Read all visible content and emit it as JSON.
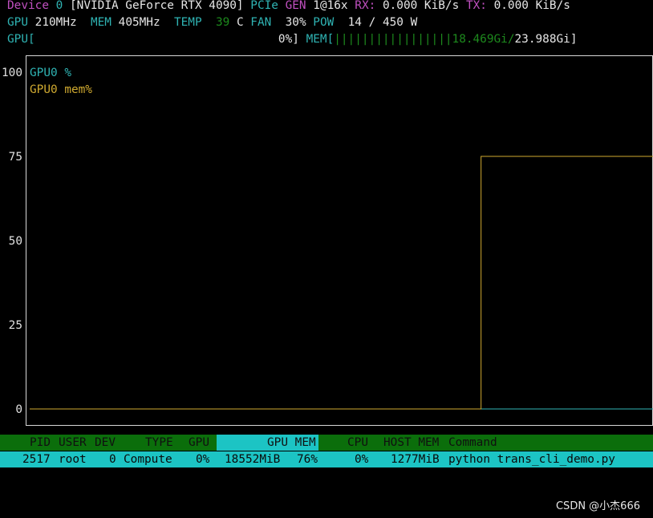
{
  "device": {
    "label": "Device",
    "index": "0",
    "name": "[NVIDIA GeForce RTX 4090]",
    "pcie_label": "PCIe",
    "gen_label": "GEN",
    "gen_value": "1@16x",
    "rx_label": "RX:",
    "rx_value": "0.000 KiB/s",
    "tx_label": "TX:",
    "tx_value": "0.000 KiB/s"
  },
  "stats": {
    "gpu_label": "GPU",
    "gpu_clock": "210MHz",
    "mem_label": "MEM",
    "mem_clock": "405MHz",
    "temp_label": "TEMP",
    "temp_value": "39",
    "temp_unit": "C",
    "fan_label": "FAN",
    "fan_value": "30%",
    "pow_label": "POW",
    "pow_value": "14 / 450 W"
  },
  "meters": {
    "gpu_label": "GPU[",
    "gpu_percent": "0%]",
    "mem_label": "MEM[",
    "mem_bars": "|||||||||||||||||",
    "mem_used": "18.469Gi/",
    "mem_total": "23.988Gi]"
  },
  "chart_data": {
    "type": "line",
    "x": [
      0,
      1,
      2,
      3,
      4,
      5,
      6,
      7,
      8,
      9,
      10,
      11,
      12,
      13,
      14,
      15,
      16,
      17,
      18,
      19,
      20,
      21,
      22,
      23,
      24,
      25,
      26,
      27,
      28,
      29
    ],
    "series": [
      {
        "name": "GPU0 %",
        "color": "#2fb3b3",
        "values": [
          0,
          0,
          0,
          0,
          0,
          0,
          0,
          0,
          0,
          0,
          0,
          0,
          0,
          0,
          0,
          0,
          0,
          0,
          0,
          0,
          0,
          0,
          0,
          0,
          0,
          0,
          0,
          0,
          0,
          0
        ]
      },
      {
        "name": "GPU0 mem%",
        "color": "#d0aa30",
        "values": [
          0,
          0,
          0,
          0,
          0,
          0,
          0,
          0,
          0,
          0,
          0,
          0,
          0,
          0,
          0,
          0,
          0,
          0,
          0,
          0,
          0,
          75,
          75,
          75,
          75,
          75,
          75,
          75,
          75,
          75
        ]
      }
    ],
    "yticks": [
      "100",
      "75",
      "50",
      "25",
      "0"
    ],
    "ylim": [
      0,
      100
    ]
  },
  "process_table": {
    "headers": [
      "PID",
      "USER",
      "DEV",
      "TYPE",
      "GPU",
      "GPU MEM",
      "CPU",
      "HOST MEM",
      "Command"
    ],
    "rows": [
      [
        "2517",
        "root",
        "0",
        "Compute",
        "0%",
        "18552MiB",
        "76%",
        "0%",
        "1277MiB",
        "python trans_cli_demo.py"
      ]
    ]
  },
  "watermark": "CSDN @小杰666"
}
